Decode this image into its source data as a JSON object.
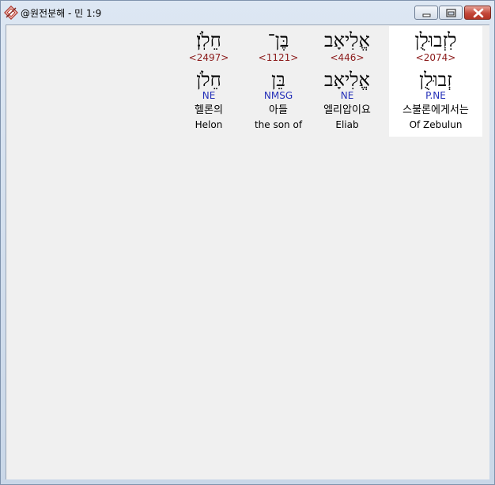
{
  "window": {
    "title": "@원전분해 - 민 1:9",
    "icon": "app-logo-icon",
    "controls": {
      "minimize": "minimize-icon",
      "maximize": "maximize-icon",
      "close": "close-icon"
    }
  },
  "colors": {
    "strong_number": "#8b1a1a",
    "morphology": "#2430b8",
    "selected_background": "#ffffff",
    "client_background": "#f0f0f0"
  },
  "words": [
    {
      "hebrew": "חֵלֹֽן׃",
      "strong": "<2497>",
      "lemma": "חֵלֹן",
      "morph": "NE",
      "korean": "헬론의",
      "english": "Helon"
    },
    {
      "hebrew": "בֶּן־",
      "strong": "<1121>",
      "lemma": "בֵּן",
      "morph": "NMSG",
      "korean": "아들",
      "english": "the son of"
    },
    {
      "hebrew": "אֱלִיאָב",
      "strong": "<446>",
      "lemma": "אֱלִיאָב",
      "morph": "NE",
      "korean": "엘리압이요",
      "english": "Eliab"
    },
    {
      "hebrew": "לִזְבוּלֻן",
      "strong": "<2074>",
      "lemma": "זְבוּלֻן",
      "morph": "P.NE",
      "korean": "스불론에게서는",
      "english": "Of Zebulun",
      "selected": true
    }
  ]
}
